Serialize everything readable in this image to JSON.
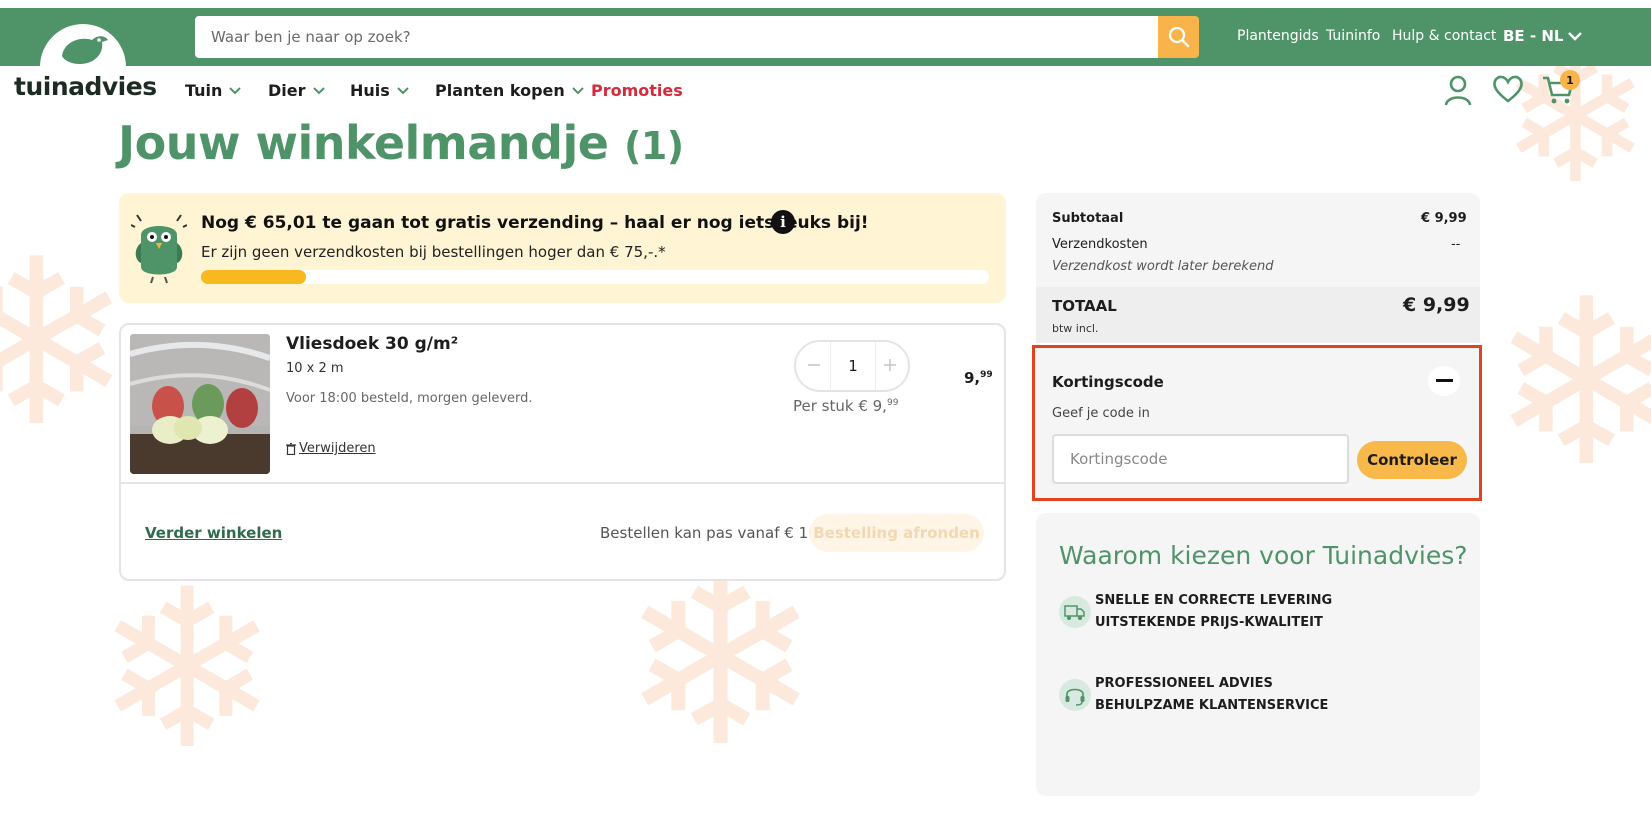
{
  "header": {
    "search_placeholder": "Waar ben je naar op zoek?",
    "top_links": [
      "Plantengids",
      "Tuininfo",
      "Hulp & contact"
    ],
    "language": "BE - NL",
    "logo_text": "tuinadvies",
    "nav": [
      {
        "label": "Tuin"
      },
      {
        "label": "Dier"
      },
      {
        "label": "Huis"
      },
      {
        "label": "Planten kopen"
      }
    ],
    "promo_label": "Promoties",
    "cart_count": "1"
  },
  "page": {
    "title": "Jouw winkelmandje",
    "title_count": "(1)"
  },
  "shipping": {
    "title": "Nog € 65,01 te gaan tot gratis verzending – haal er nog iets leuks bij!",
    "info_glyph": "i",
    "subtitle": "Er zijn geen verzendkosten bij bestellingen hoger dan € 75,-.*",
    "progress_fraction": 0.133
  },
  "product": {
    "name": "Vliesdoek 30 g/m²",
    "size": "10 x 2 m",
    "delivery_note": "Voor 18:00 besteld, morgen geleverd.",
    "remove_label": "Verwijderen",
    "quantity": "1",
    "per_label": "Per stuk € 9,",
    "per_cents": "99",
    "price_main": "9,",
    "price_cents": "99"
  },
  "cart_footer": {
    "continue_label": "Verder winkelen",
    "min_order_note": "Bestellen kan pas vanaf € 10",
    "checkout_label": "Bestelling afronden"
  },
  "summary": {
    "subtotal_label": "Subtotaal",
    "subtotal_value": "€ 9,99",
    "shipping_label": "Verzendkosten",
    "shipping_value": "--",
    "shipping_note": "Verzendkost wordt later berekend",
    "total_label": "TOTAAL",
    "total_value": "€ 9,99",
    "vat_note": "btw incl."
  },
  "discount": {
    "title": "Kortingscode",
    "subtitle": "Geef je code in",
    "input_placeholder": "Kortingscode",
    "button_label": "Controleer"
  },
  "why": {
    "title": "Waarom kiezen voor Tuinadvies?",
    "items": [
      {
        "line1": "SNELLE EN CORRECTE LEVERING",
        "line2": "UITSTEKENDE PRIJS-KWALITEIT",
        "icon": "truck-icon"
      },
      {
        "line1": "PROFESSIONEEL ADVIES",
        "line2": "BEHULPZAME KLANTENSERVICE",
        "icon": "headset-icon"
      }
    ]
  },
  "colors": {
    "brand_green": "#4e9468",
    "accent_yellow": "#f8b44a",
    "promo_red": "#d6293b",
    "highlight_border": "#e1431f"
  }
}
